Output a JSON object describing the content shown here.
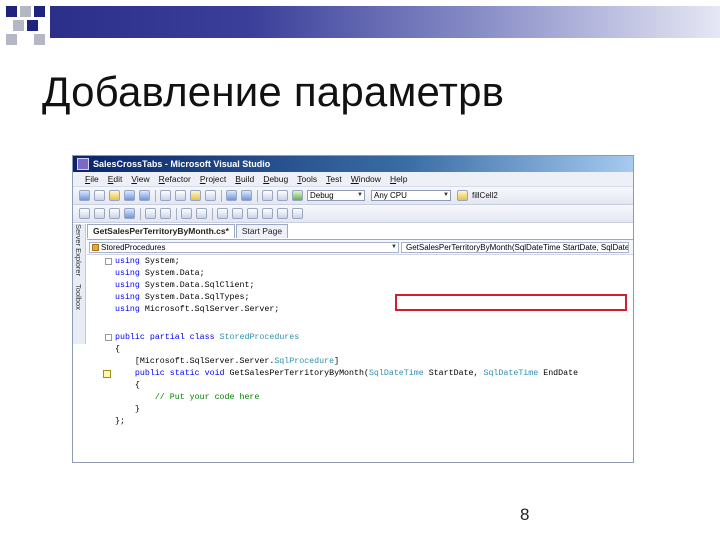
{
  "slide": {
    "title": "Добавление параметрв",
    "page_number": "8"
  },
  "window": {
    "title": "SalesCrossTabs - Microsoft Visual Studio"
  },
  "menu": [
    "File",
    "Edit",
    "View",
    "Refactor",
    "Project",
    "Build",
    "Debug",
    "Tools",
    "Test",
    "Window",
    "Help"
  ],
  "toolbar": {
    "config_combo": "Debug",
    "platform_combo": "Any CPU",
    "find_text": "fillCell2"
  },
  "side_panel": [
    "Server Explorer",
    "Toolbox"
  ],
  "tabs": [
    {
      "label": "GetSalesPerTerritoryByMonth.cs*"
    },
    {
      "label": "Start Page"
    }
  ],
  "nav": {
    "class_combo": "StoredProcedures",
    "member_combo": "GetSalesPerTerritoryByMonth(SqlDateTime StartDate, SqlDateTime"
  },
  "code": {
    "line1_kw": "using",
    "line1_rest": " System;",
    "line2_kw": "using",
    "line2_rest": " System.Data;",
    "line3_kw": "using",
    "line3_rest": " System.Data.SqlClient;",
    "line4_kw": "using",
    "line4_rest": " System.Data.SqlTypes;",
    "line5_kw": "using",
    "line5_rest": " Microsoft.SqlServer.Server;",
    "line6_kw": "public partial class",
    "line6_type": " StoredProcedures",
    "line7": "{",
    "line8_pre": "    [Microsoft.SqlServer.Server.",
    "line8_type": "SqlProcedure",
    "line8_post": "]",
    "line9_kw": "    public static void",
    "line9_name": " GetSalesPerTerritoryByMonth(",
    "line9_type1": "SqlDateTime",
    "line9_mid": " StartDate, ",
    "line9_type2": "SqlDateTime",
    "line9_end": " EndDate",
    "line10": "    {",
    "line11_comment": "        // Put your code here",
    "line12": "    }",
    "line13": "};"
  }
}
